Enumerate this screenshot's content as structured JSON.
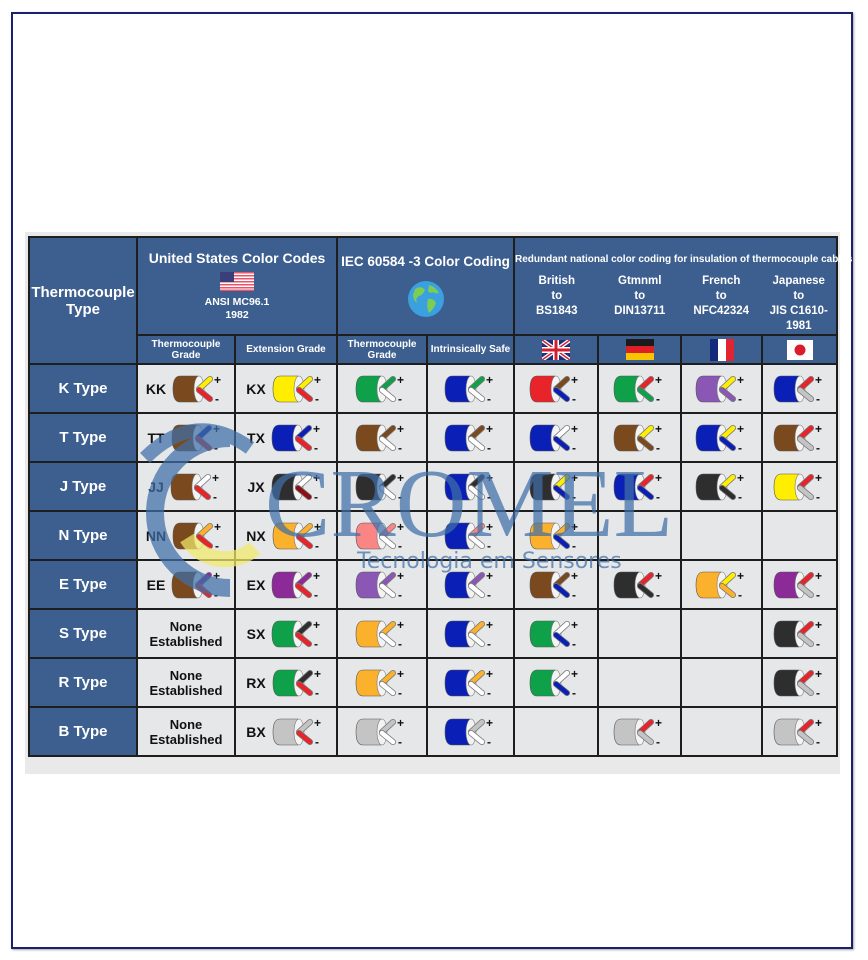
{
  "header": {
    "type_col": "Thermocouple Type",
    "us": {
      "title": "United States Color Codes",
      "std": "ANSI MC96.1",
      "year": "1982",
      "flag_icon": "us-flag-icon"
    },
    "iec": {
      "title": "IEC 60584 -3 Color Coding",
      "icon": "globe-icon"
    },
    "national": {
      "title": "Redundant national color coding for insulation of thermocouple cables",
      "countries": [
        {
          "name": "British",
          "to": "to",
          "std": "BS1843",
          "flag_icon": "uk-flag-icon"
        },
        {
          "name": "Gtmnml",
          "to": "to",
          "std": "DIN13711",
          "flag_icon": "germany-flag-icon"
        },
        {
          "name": "French",
          "to": "to",
          "std": "NFC42324",
          "flag_icon": "france-flag-icon"
        },
        {
          "name": "Japanese",
          "to": "to",
          "std": "JIS C1610-1981",
          "flag_icon": "japan-flag-icon"
        }
      ]
    },
    "subheaders": {
      "us_tc": "Thermocouple Grade",
      "us_ext": "Extension Grade",
      "iec_tc": "Thermocouple Grade",
      "iec_is": "Intrinsically Safe"
    }
  },
  "colors": {
    "brown": "#7a4a1e",
    "yellow": "#ffee00",
    "red": "#e8242a",
    "green": "#0fa14a",
    "blue": "#0a1fb5",
    "black": "#2e2e2e",
    "white": "#ffffff",
    "orange": "#fbb12b",
    "pink": "#f98585",
    "purple": "#8c2a98",
    "violet": "#8a57b5",
    "grey": "#c4c4c4",
    "darkred": "#8e0e17",
    "header_bg": "#3d5f8f",
    "cell_bg": "#e6e7e9"
  },
  "plus": "+",
  "minus": "-",
  "none_text": [
    "None",
    "Established"
  ],
  "rows": [
    {
      "type": "K Type",
      "us_tc": {
        "label": "KK",
        "jacket": "brown",
        "pos": "yellow",
        "neg": "red"
      },
      "us_ext": {
        "label": "KX",
        "jacket": "yellow",
        "pos": "yellow",
        "neg": "red"
      },
      "iec_tc": {
        "jacket": "green",
        "pos": "green",
        "neg": "white"
      },
      "iec_is": {
        "jacket": "blue",
        "pos": "green",
        "neg": "white"
      },
      "british": {
        "jacket": "red",
        "pos": "brown",
        "neg": "blue"
      },
      "german": {
        "jacket": "green",
        "pos": "red",
        "neg": "green"
      },
      "french": {
        "jacket": "violet",
        "pos": "yellow",
        "neg": "violet"
      },
      "japanese": {
        "jacket": "blue",
        "pos": "red",
        "neg": "grey"
      }
    },
    {
      "type": "T Type",
      "us_tc": {
        "label": "TT",
        "jacket": "brown",
        "pos": "blue",
        "neg": "red"
      },
      "us_ext": {
        "label": "TX",
        "jacket": "blue",
        "pos": "blue",
        "neg": "red"
      },
      "iec_tc": {
        "jacket": "brown",
        "pos": "brown",
        "neg": "white"
      },
      "iec_is": {
        "jacket": "blue",
        "pos": "brown",
        "neg": "white"
      },
      "british": {
        "jacket": "blue",
        "pos": "white",
        "neg": "blue"
      },
      "german": {
        "jacket": "brown",
        "pos": "yellow",
        "neg": "brown"
      },
      "french": {
        "jacket": "blue",
        "pos": "yellow",
        "neg": "blue"
      },
      "japanese": {
        "jacket": "brown",
        "pos": "red",
        "neg": "grey"
      }
    },
    {
      "type": "J Type",
      "us_tc": {
        "label": "JJ",
        "jacket": "brown",
        "pos": "white",
        "neg": "red"
      },
      "us_ext": {
        "label": "JX",
        "jacket": "black",
        "pos": "white",
        "neg": "darkred"
      },
      "iec_tc": {
        "jacket": "black",
        "pos": "black",
        "neg": "white"
      },
      "iec_is": {
        "jacket": "blue",
        "pos": "black",
        "neg": "white"
      },
      "british": {
        "jacket": "black",
        "pos": "yellow",
        "neg": "blue"
      },
      "german": {
        "jacket": "blue",
        "pos": "red",
        "neg": "blue"
      },
      "french": {
        "jacket": "black",
        "pos": "yellow",
        "neg": "black"
      },
      "japanese": {
        "jacket": "yellow",
        "pos": "red",
        "neg": "grey"
      }
    },
    {
      "type": "N Type",
      "us_tc": {
        "label": "NN",
        "jacket": "brown",
        "pos": "orange",
        "neg": "red"
      },
      "us_ext": {
        "label": "NX",
        "jacket": "orange",
        "pos": "orange",
        "neg": "red"
      },
      "iec_tc": {
        "jacket": "pink",
        "pos": "pink",
        "neg": "white"
      },
      "iec_is": {
        "jacket": "blue",
        "pos": "pink",
        "neg": "white"
      },
      "british": {
        "jacket": "orange",
        "pos": "orange",
        "neg": "blue"
      },
      "german": null,
      "french": null,
      "japanese": null
    },
    {
      "type": "E Type",
      "us_tc": {
        "label": "EE",
        "jacket": "brown",
        "pos": "purple",
        "neg": "red"
      },
      "us_ext": {
        "label": "EX",
        "jacket": "purple",
        "pos": "purple",
        "neg": "red"
      },
      "iec_tc": {
        "jacket": "violet",
        "pos": "violet",
        "neg": "white"
      },
      "iec_is": {
        "jacket": "blue",
        "pos": "violet",
        "neg": "white"
      },
      "british": {
        "jacket": "brown",
        "pos": "brown",
        "neg": "blue"
      },
      "german": {
        "jacket": "black",
        "pos": "red",
        "neg": "black"
      },
      "french": {
        "jacket": "orange",
        "pos": "yellow",
        "neg": "orange"
      },
      "japanese": {
        "jacket": "purple",
        "pos": "red",
        "neg": "grey"
      }
    },
    {
      "type": "S Type",
      "us_tc": null,
      "us_ext": {
        "label": "SX",
        "jacket": "green",
        "pos": "black",
        "neg": "red"
      },
      "iec_tc": {
        "jacket": "orange",
        "pos": "orange",
        "neg": "white"
      },
      "iec_is": {
        "jacket": "blue",
        "pos": "orange",
        "neg": "white"
      },
      "british": {
        "jacket": "green",
        "pos": "white",
        "neg": "blue"
      },
      "german": null,
      "french": null,
      "japanese": {
        "jacket": "black",
        "pos": "red",
        "neg": "grey"
      }
    },
    {
      "type": "R Type",
      "us_tc": null,
      "us_ext": {
        "label": "RX",
        "jacket": "green",
        "pos": "black",
        "neg": "red"
      },
      "iec_tc": {
        "jacket": "orange",
        "pos": "orange",
        "neg": "white"
      },
      "iec_is": {
        "jacket": "blue",
        "pos": "orange",
        "neg": "white"
      },
      "british": {
        "jacket": "green",
        "pos": "white",
        "neg": "blue"
      },
      "german": null,
      "french": null,
      "japanese": {
        "jacket": "black",
        "pos": "red",
        "neg": "grey"
      }
    },
    {
      "type": "B Type",
      "us_tc": null,
      "us_ext": {
        "label": "BX",
        "jacket": "grey",
        "pos": "grey",
        "neg": "red"
      },
      "iec_tc": {
        "jacket": "grey",
        "pos": "grey",
        "neg": "white"
      },
      "iec_is": {
        "jacket": "blue",
        "pos": "grey",
        "neg": "white"
      },
      "british": null,
      "german": {
        "jacket": "grey",
        "pos": "red",
        "neg": "grey"
      },
      "french": null,
      "japanese": {
        "jacket": "grey",
        "pos": "red",
        "neg": "grey"
      }
    }
  ],
  "watermark": {
    "brand": "CROMEL",
    "tagline": "Tecnologia em Sensores"
  }
}
